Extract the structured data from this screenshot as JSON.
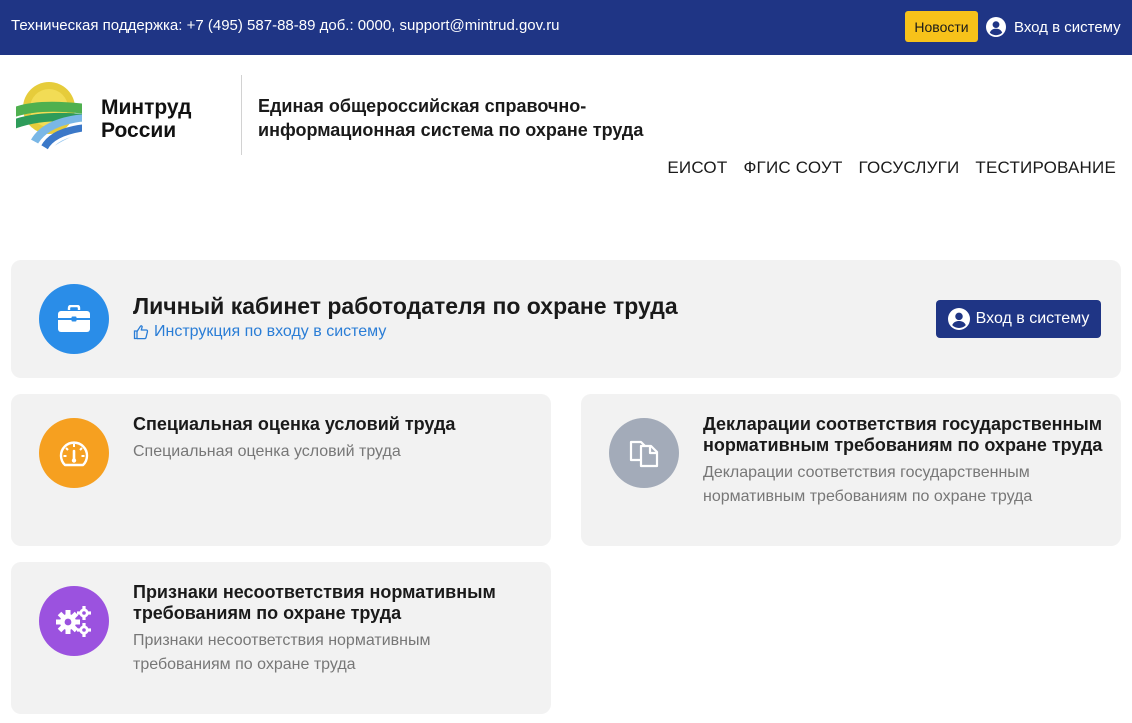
{
  "topbar": {
    "support_text": "Техническая поддержка: +7 (495) 587-88-89 доб.: 0000, support@mintrud.gov.ru",
    "news_label": "Новости",
    "login_label": "Вход в систему"
  },
  "header": {
    "brand_line1": "Минтруд",
    "brand_line2": "России",
    "system_name": "Единая общероссийская справочно-информационная система по охране труда"
  },
  "nav": {
    "items": [
      "ЕИСОТ",
      "ФГИС СОУТ",
      "ГОСУСЛУГИ",
      "ТЕСТИРОВАНИЕ"
    ]
  },
  "hero": {
    "title": "Личный кабинет работодателя по охране труда",
    "instruction_link": "Инструкция по входу в систему",
    "login_label": "Вход в систему"
  },
  "cards": [
    {
      "title": "Специальная оценка условий труда",
      "description": "Специальная оценка условий труда",
      "icon": "gauge-icon",
      "color": "#f6a020"
    },
    {
      "title": "Декларации соответствия государственным нормативным требованиям по охране труда",
      "description": "Декларации соответствия государственным нормативным требованиям по охране труда",
      "icon": "documents-icon",
      "color": "#a3abb9"
    },
    {
      "title": "Признаки несоответствия нормативным требованиям по охране труда",
      "description": "Признаки несоответствия нормативным требованиям по охране труда",
      "icon": "gears-icon",
      "color": "#9b52df"
    }
  ],
  "colors": {
    "primary": "#1f3585",
    "accent": "#f7c21a",
    "link": "#2a7dd6",
    "card_bg": "#f2f2f2"
  }
}
